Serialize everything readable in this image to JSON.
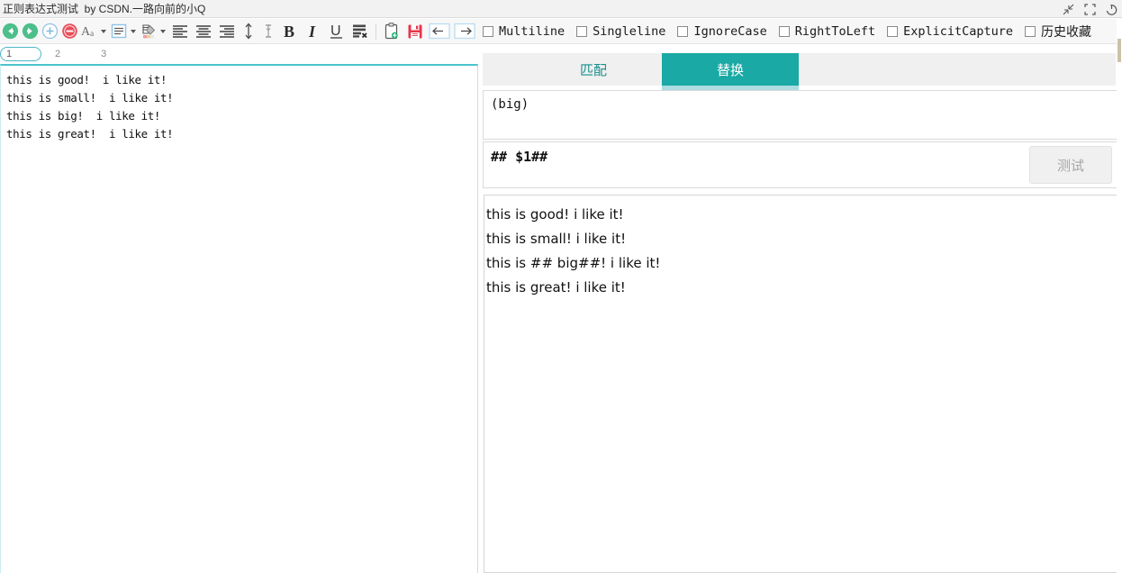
{
  "window": {
    "title": "正则表达式测试  by CSDN.一路向前的小Q",
    "controls": [
      {
        "name": "restore-down-icon",
        "label": "还原"
      },
      {
        "name": "maximize-icon",
        "label": "最大化"
      },
      {
        "name": "power-close-icon",
        "label": "关闭"
      }
    ]
  },
  "toolbar": {
    "items": [
      {
        "name": "back-icon",
        "label": "后退"
      },
      {
        "name": "forward-icon",
        "label": "前进"
      },
      {
        "name": "zoom-in-icon",
        "label": "放大"
      },
      {
        "name": "zoom-out-icon",
        "label": "缩小"
      },
      {
        "name": "font-icon",
        "label": "Aa"
      },
      {
        "name": "paragraph-icon",
        "label": "段落"
      },
      {
        "name": "text-color-icon",
        "label": "颜色"
      },
      {
        "name": "align-left-icon",
        "label": "左对齐"
      },
      {
        "name": "align-center-icon",
        "label": "居中"
      },
      {
        "name": "align-right-icon",
        "label": "右对齐"
      },
      {
        "name": "line-spacing-icon",
        "label": "行距"
      },
      {
        "name": "char-spacing-icon",
        "label": "字距"
      },
      {
        "name": "bold-icon",
        "label": "B"
      },
      {
        "name": "italic-icon",
        "label": "I"
      },
      {
        "name": "underline-icon",
        "label": "U"
      },
      {
        "name": "clear-format-icon",
        "label": "清除格式"
      },
      {
        "name": "paste-icon",
        "label": "粘贴"
      },
      {
        "name": "save-icon",
        "label": "保存"
      },
      {
        "name": "import-icon",
        "label": "导入"
      },
      {
        "name": "export-icon",
        "label": "导出"
      }
    ]
  },
  "options": [
    {
      "label": "Multiline",
      "checked": false,
      "cjk": false
    },
    {
      "label": "Singleline",
      "checked": false,
      "cjk": false
    },
    {
      "label": "IgnoreCase",
      "checked": false,
      "cjk": false
    },
    {
      "label": "RightToLeft",
      "checked": false,
      "cjk": false
    },
    {
      "label": "ExplicitCapture",
      "checked": false,
      "cjk": false
    },
    {
      "label": "历史收藏",
      "checked": false,
      "cjk": true
    }
  ],
  "page_tabs": [
    {
      "label": "1",
      "active": true
    },
    {
      "label": "2",
      "active": false
    },
    {
      "label": "3",
      "active": false
    }
  ],
  "editor": {
    "lines": [
      "this is good!  i like it!",
      "this is small!  i like it!",
      "this is big!  i like it!",
      "this is great!  i like it!"
    ]
  },
  "right_panel": {
    "tabs": [
      {
        "label": "匹配",
        "active": false
      },
      {
        "label": "替换",
        "active": true
      }
    ],
    "pattern": "(big)",
    "replacement": "## $1##",
    "test_button": "测试",
    "result_lines": [
      "this is good! i like it!",
      "this is small! i like it!",
      "this is ## big##! i like it!",
      "this is great! i like it!"
    ]
  },
  "colors": {
    "teal_accent": "#1aa9a5",
    "tab_underline": "#addce2",
    "editor_top_border": "#4cc3cd",
    "titlebar_bg": "#f2f2f2",
    "toolbar_bg": "#f7f7f7",
    "tabbar_bg": "#f0f0f0",
    "disabled_text": "#a6a6a6",
    "green_nav": "#4cbf8a",
    "red_stop": "#e8505b",
    "blue_add": "#7fb9e0"
  }
}
